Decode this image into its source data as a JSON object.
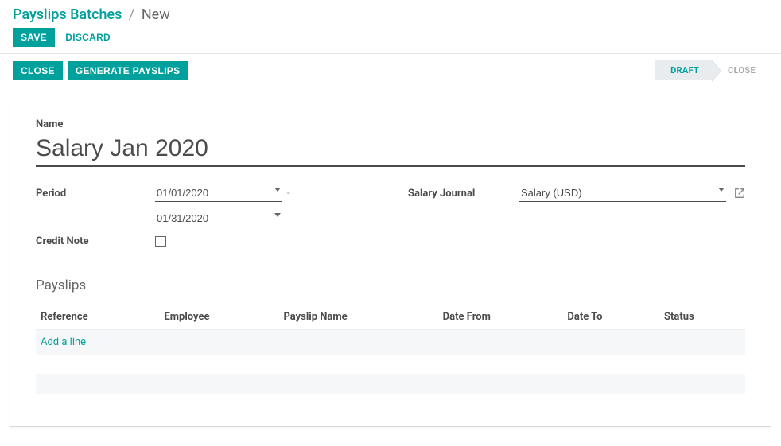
{
  "breadcrumb": {
    "root": "Payslips Batches",
    "current": "New"
  },
  "buttons": {
    "save": "SAVE",
    "discard": "DISCARD",
    "close": "CLOSE",
    "generate": "GENERATE PAYSLIPS"
  },
  "status": {
    "draft": "DRAFT",
    "close": "CLOSE"
  },
  "form": {
    "name_label": "Name",
    "name_value": "Salary Jan 2020",
    "period_label": "Period",
    "period_from": "01/01/2020",
    "period_to": "01/31/2020",
    "credit_note_label": "Credit Note",
    "salary_journal_label": "Salary Journal",
    "salary_journal_value": "Salary (USD)"
  },
  "payslips": {
    "section_title": "Payslips",
    "columns": {
      "reference": "Reference",
      "employee": "Employee",
      "payslip_name": "Payslip Name",
      "date_from": "Date From",
      "date_to": "Date To",
      "status": "Status"
    },
    "add_line": "Add a line"
  }
}
